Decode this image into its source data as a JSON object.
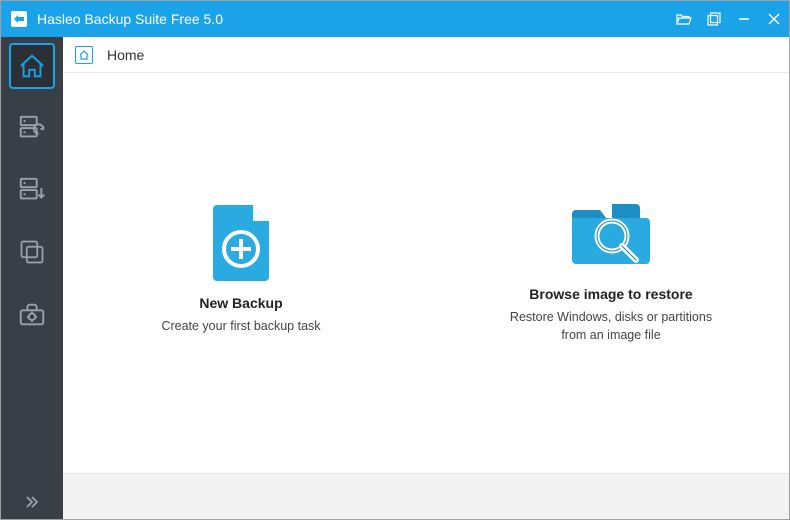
{
  "titlebar": {
    "app_title": "Hasleo Backup Suite Free 5.0"
  },
  "breadcrumb": {
    "label": "Home"
  },
  "actions": {
    "new_backup": {
      "title": "New Backup",
      "desc": "Create your first backup task"
    },
    "browse_restore": {
      "title": "Browse image to restore",
      "desc": "Restore Windows, disks or partitions from an image file"
    }
  },
  "colors": {
    "accent": "#1aa3e8",
    "sidebar_bg": "#393f46"
  }
}
